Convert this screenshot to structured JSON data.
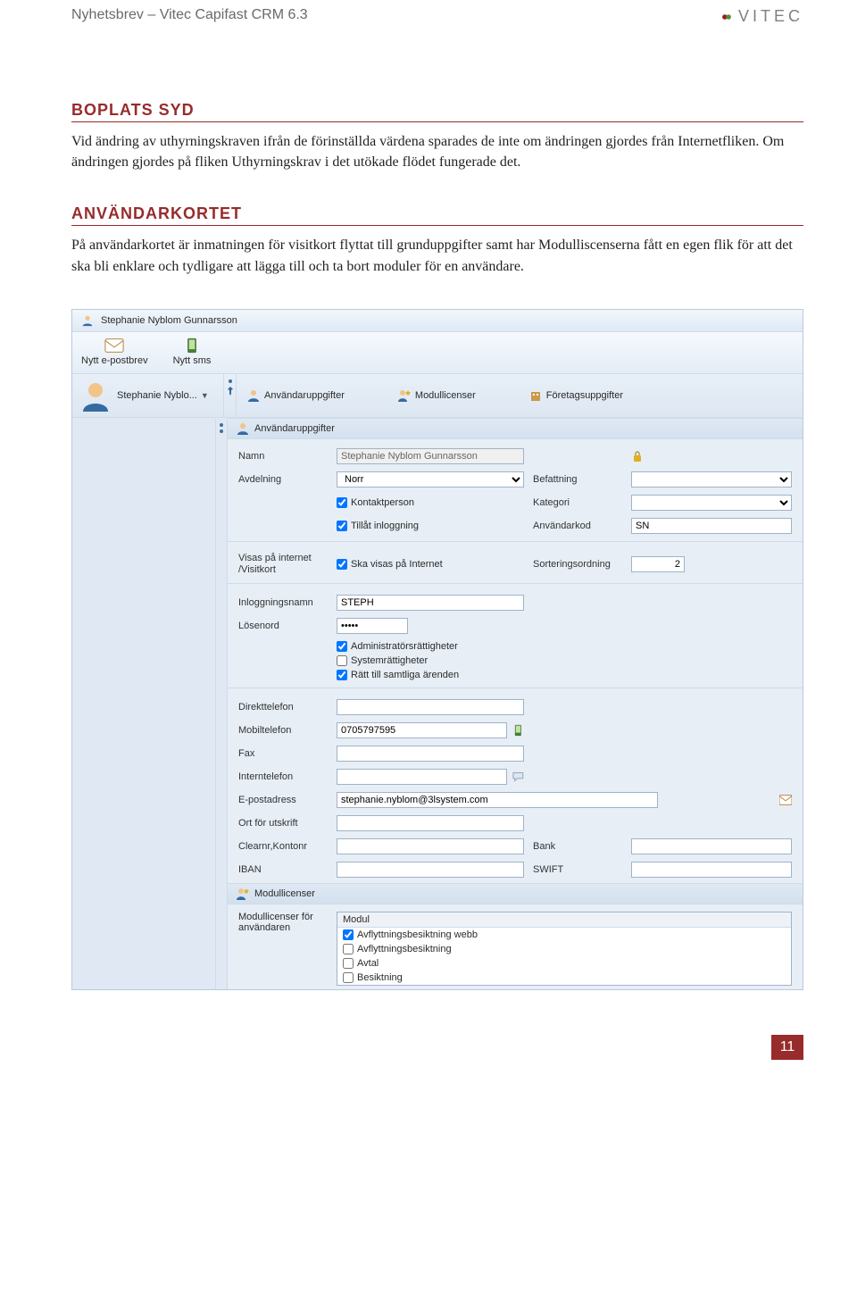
{
  "header": {
    "title": "Nyhetsbrev – Vitec Capifast CRM 6.3",
    "logo_text": "VITEC"
  },
  "sections": {
    "boplats": {
      "heading": "BOPLATS SYD",
      "body": "Vid ändring av uthyrningskraven ifrån de förinställda värdena sparades de inte om ändringen gjordes från Internetfliken. Om ändringen gjordes på fliken Uthyrningskrav i det utökade flödet fungerade det."
    },
    "anvandarkortet": {
      "heading": "ANVÄNDARKORTET",
      "body": "På användarkortet är inmatningen för visitkort flyttat till grunduppgifter samt har Modulliscenserna fått en egen flik för att det ska bli enklare och tydligare att lägga till och ta bort moduler för en användare."
    }
  },
  "app": {
    "window_title": "Stephanie Nyblom Gunnarsson",
    "toolbar": {
      "email": "Nytt e-postbrev",
      "sms": "Nytt sms"
    },
    "sidebar": {
      "current": "Stephanie Nyblo..."
    },
    "tabs": {
      "anvandaruppgifter": "Användaruppgifter",
      "modullicenser": "Modullicenser",
      "foretagsuppgifter": "Företagsuppgifter"
    },
    "form": {
      "section1_title": "Användaruppgifter",
      "labels": {
        "namn": "Namn",
        "avdelning": "Avdelning",
        "befattning": "Befattning",
        "kategori": "Kategori",
        "anvandarkod": "Användarkod",
        "visas_internet": "Visas på internet /Visitkort",
        "sorteringsordning": "Sorteringsordning",
        "inloggningsnamn": "Inloggningsnamn",
        "losenord": "Lösenord",
        "direkttelefon": "Direkttelefon",
        "mobiltelefon": "Mobiltelefon",
        "fax": "Fax",
        "interntelefon": "Interntelefon",
        "epost": "E-postadress",
        "ort_utskrift": "Ort för utskrift",
        "clearnr": "Clearnr,Kontonr",
        "bank": "Bank",
        "iban": "IBAN",
        "swift": "SWIFT"
      },
      "values": {
        "namn": "Stephanie Nyblom Gunnarsson",
        "avdelning": "Norr",
        "anvandarkod": "SN",
        "sorteringsordning": "2",
        "inloggningsnamn": "STEPH",
        "losenord": "•••••",
        "mobiltelefon": "0705797595",
        "epost": "stephanie.nyblom@3lsystem.com"
      },
      "checks": {
        "kontaktperson": "Kontaktperson",
        "tillat_inloggning": "Tillåt inloggning",
        "ska_visas": "Ska visas på Internet",
        "admin": "Administratörsrättigheter",
        "system": "Systemrättigheter",
        "ratt_arenden": "Rätt till samtliga ärenden"
      },
      "section2_title": "Modullicenser",
      "modul_label": "Modullicenser för användaren",
      "modul_header": "Modul",
      "modules": {
        "m1": "Avflyttningsbesiktning webb",
        "m2": "Avflyttningsbesiktning",
        "m3": "Avtal",
        "m4": "Besiktning"
      }
    }
  },
  "page_number": "11"
}
